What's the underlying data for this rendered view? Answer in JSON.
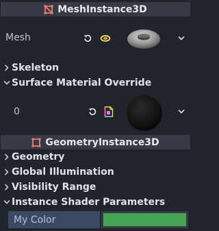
{
  "sections": {
    "mesh_instance": {
      "title": "MeshInstance3D",
      "icon": "mesh-instance-3d-icon",
      "icon_color": "#fc7f7f"
    },
    "geometry_instance": {
      "title": "GeometryInstance3D",
      "icon": "geometry-instance-3d-icon",
      "icon_color": "#fc7f7f"
    }
  },
  "mesh_row": {
    "label": "Mesh",
    "revert_icon": "revert-icon",
    "type_icon": "torus-mesh-icon",
    "preview": "torus-mesh-preview",
    "dropdown_icon": "chevron-down-icon"
  },
  "categories": {
    "skeleton": {
      "label": "Skeleton",
      "expanded": false
    },
    "surface_material_override": {
      "label": "Surface Material Override",
      "expanded": true
    },
    "geometry": {
      "label": "Geometry",
      "expanded": false
    },
    "global_illumination": {
      "label": "Global Illumination",
      "expanded": false
    },
    "visibility_range": {
      "label": "Visibility Range",
      "expanded": false
    },
    "instance_shader_parameters": {
      "label": "Instance Shader Parameters",
      "expanded": true
    }
  },
  "surface_row": {
    "label": "0",
    "revert_icon": "revert-icon",
    "type_icon": "material-resource-icon",
    "preview": "material-sphere-preview",
    "dropdown_icon": "chevron-down-icon"
  },
  "shader_params": [
    {
      "label": "My Color",
      "color": "#45a356"
    }
  ],
  "colors": {
    "panel_bg": "#21252b",
    "header_bg": "#353a44",
    "accent": "#ffdd65",
    "selected_label_bg": "#394966"
  }
}
